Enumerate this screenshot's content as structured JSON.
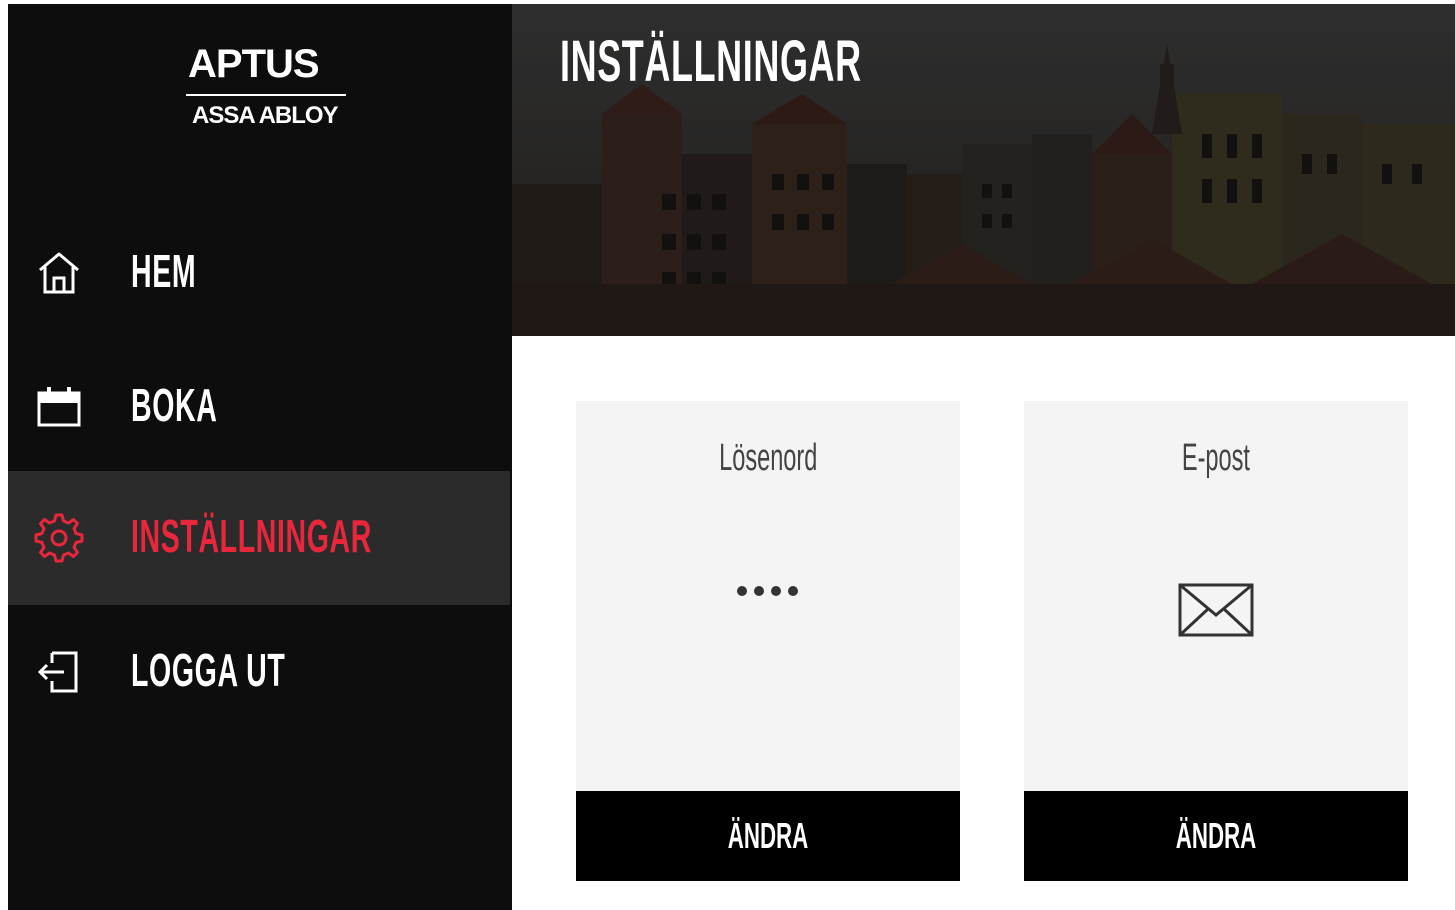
{
  "brand": {
    "name": "APTUS",
    "subtitle": "ASSA ABLOY"
  },
  "nav": {
    "items": [
      {
        "label": "HEM",
        "icon": "home-icon",
        "active": false
      },
      {
        "label": "BOKA",
        "icon": "calendar-icon",
        "active": false
      },
      {
        "label": "INSTÄLLNINGAR",
        "icon": "gear-icon",
        "active": true
      },
      {
        "label": "LOGGA UT",
        "icon": "logout-icon",
        "active": false
      }
    ]
  },
  "header": {
    "title": "INSTÄLLNINGAR"
  },
  "cards": [
    {
      "title": "Lösenord",
      "icon": "password-dots-icon",
      "button_label": "ÄNDRA"
    },
    {
      "title": "E-post",
      "icon": "envelope-icon",
      "button_label": "ÄNDRA"
    }
  ],
  "colors": {
    "accent": "#e8273c",
    "sidebar": "#0d0d0d",
    "active_bg": "#2b2b2b",
    "card_bg": "#f4f4f4"
  }
}
